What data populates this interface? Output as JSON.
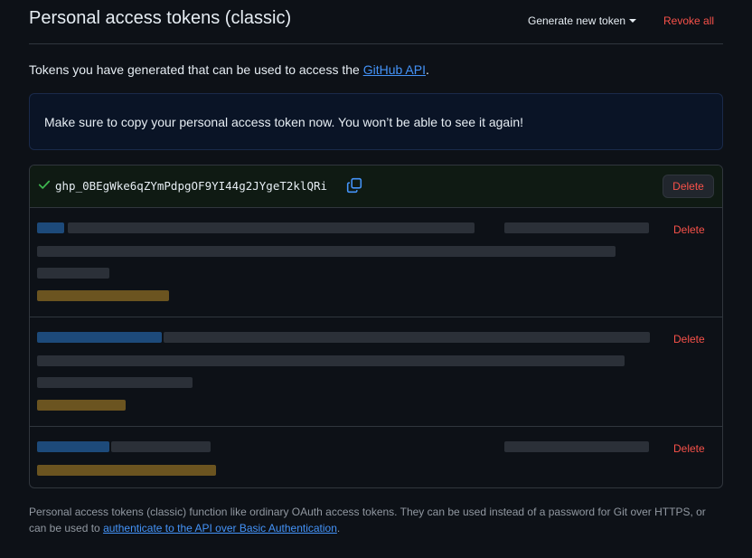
{
  "header": {
    "title": "Personal access tokens (classic)",
    "generate_label": "Generate new token",
    "revoke_label": "Revoke all"
  },
  "intro": {
    "text": "Tokens you have generated that can be used to access the ",
    "link": "GitHub API",
    "suffix": "."
  },
  "flash": {
    "text": "Make sure to copy your personal access token now. You won’t be able to see it again!"
  },
  "new_token": {
    "value": "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",
    "delete_label": "Delete"
  },
  "tokens": [
    {
      "delete_label": "Delete"
    },
    {
      "delete_label": "Delete"
    },
    {
      "delete_label": "Delete"
    }
  ],
  "footer": {
    "text": "Personal access tokens (classic) function like ordinary OAuth access tokens. They can be used instead of a password for Git over HTTPS, or can be used to ",
    "link": "authenticate to the API over Basic Authentication",
    "suffix": "."
  },
  "colors": {
    "background": "#0d1117",
    "border": "#30363d",
    "link": "#4493f8",
    "danger": "#f85149",
    "success": "#3fb950",
    "muted": "#9198a1"
  },
  "icons": {
    "check": "check-icon",
    "copy": "copy-icon",
    "caret": "caret-down-icon"
  }
}
